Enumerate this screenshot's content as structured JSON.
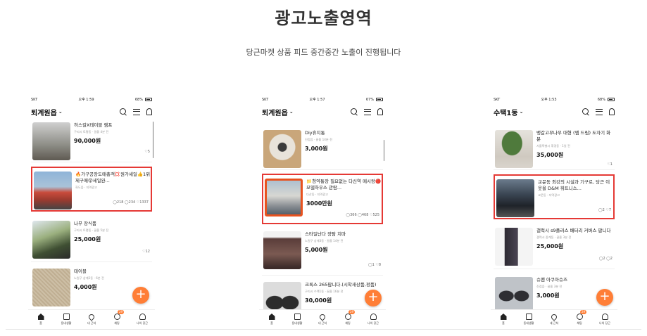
{
  "page": {
    "title": "광고노출영역",
    "subtitle": "당근마켓 상품 피드 중간중간 노출이 진행됩니다"
  },
  "phones": [
    {
      "status": {
        "carrier": "SKT",
        "time": "오후 1:59",
        "battery": "68%"
      },
      "location": "퇴계원읍",
      "items": [
        {
          "title": "허스칼X테이블 램프",
          "meta": "구리시 토평동 · 끌올 4분 전",
          "price": "90,000원",
          "stats": "♡5",
          "ad": false
        },
        {
          "title": "🔥가구공장도매총객💢원가세일👍1위제구매😲세일완...",
          "meta": "화도읍 · 지역광고",
          "price": "",
          "stats": "◯218 ◯234 ♡1337",
          "ad": true
        },
        {
          "title": "나무 장식품",
          "meta": "구리시 토평동 · 끌올 5분 전",
          "price": "25,000원",
          "stats": "♡12",
          "ad": false
        },
        {
          "title": "테이블",
          "meta": "노원구 상계2동 · 6분 전",
          "price": "4,000원",
          "stats": "",
          "ad": false
        }
      ],
      "tabbar": {
        "tabs": [
          "홈",
          "동네생활",
          "내 근처",
          "채팅",
          "나의 당근"
        ],
        "badge": "29"
      }
    },
    {
      "status": {
        "carrier": "SKT",
        "time": "오후 1:57",
        "battery": "67%"
      },
      "location": "퇴계원읍",
      "items": [
        {
          "title": "Diy휴지통",
          "meta": "진접읍 · 끌올 14분 전",
          "price": "3,000원",
          "stats": "",
          "ad": false
        },
        {
          "title": "📁청약통장 필요없는 다신역 메시랑🔴모델하우스 관람...",
          "meta": "다산동 · 지역광고",
          "price": "3000만원",
          "stats": "◯366 ◯468 ♡525",
          "ad": true
        },
        {
          "title": "스타일난다 장탐 치마",
          "meta": "노원구 상계3동 · 끌올 14분 전",
          "price": "5,000원",
          "stats": "◯1 ♡8",
          "ad": false
        },
        {
          "title": "크록스 265팝니다.(시착새상품,정품)",
          "meta": "구리시 수택1동 · 끌올 16분 전",
          "price": "30,000원",
          "stats": "",
          "ad": false
        }
      ],
      "tabbar": {
        "tabs": [
          "홈",
          "동네생활",
          "내 근처",
          "채팅",
          "나의 당근"
        ],
        "badge": "29"
      }
    },
    {
      "status": {
        "carrier": "SKT",
        "time": "오후 1:53",
        "battery": "68%"
      },
      "location": "수택1동",
      "items": [
        {
          "title": "뱅갈고무나무 대형 (엠 드림) 도자기 화분",
          "meta": "서울특별시 휘경동 · 1일 전",
          "price": "35,000원",
          "stats": "♡1",
          "ad": false
        },
        {
          "title": "교문동 최강의 시설과 기구로, 당근 이웃을 D&M 휘트니스...",
          "meta": "교문동 · 지역광고",
          "price": "",
          "stats": "◯2 ♡7",
          "ad": true
        },
        {
          "title": "갤럭시 s9플러스 배터리 커버스 팝니다",
          "meta": "갤럭시 중계동 · 끌올 3분 전",
          "price": "25,000원",
          "stats": "◯2 ◯2",
          "ad": false
        },
        {
          "title": "슈펜 아쿠아슈즈",
          "meta": "진접읍 · 끌올 3분 전",
          "price": "3,000원",
          "stats": "",
          "ad": false
        }
      ],
      "tabbar": {
        "tabs": [
          "홈",
          "동네생활",
          "내 근처",
          "채팅",
          "나의 당근"
        ],
        "badge": "29"
      }
    }
  ],
  "colors": {
    "accent": "#ff7e36",
    "ad_border": "#e53935"
  },
  "icons": [
    "search-icon",
    "menu-icon",
    "bell-icon",
    "home-icon",
    "doc-icon",
    "pin-icon",
    "chat-icon",
    "user-icon",
    "plus-icon"
  ],
  "fab_label": "+"
}
